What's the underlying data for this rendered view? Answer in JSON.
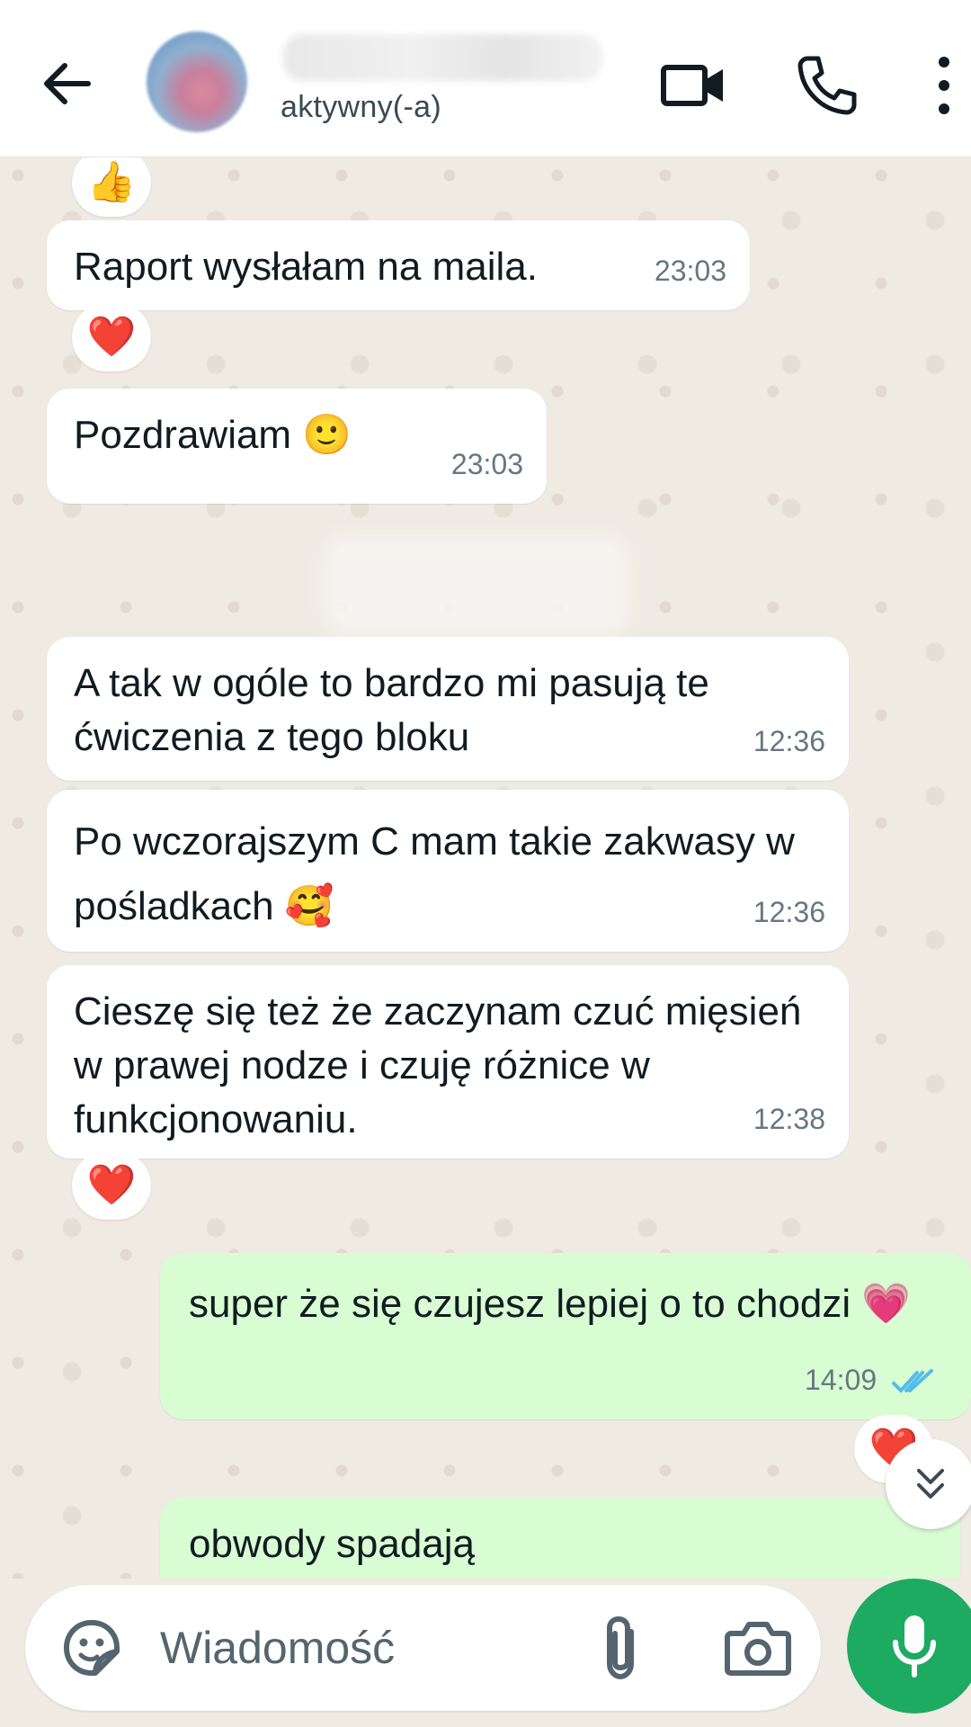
{
  "header": {
    "back_icon": "arrow-left-icon",
    "contact_name": "",
    "status": "aktywny(-a)",
    "video_icon": "video-camera-icon",
    "call_icon": "phone-icon",
    "menu_icon": "more-vertical-icon"
  },
  "messages": [
    {
      "direction": "incoming",
      "text": "Raport wysłałam na maila.",
      "time": "23:03",
      "reaction": "❤️"
    },
    {
      "direction": "incoming",
      "text": "Pozdrawiam 🙂",
      "time": "23:03"
    },
    {
      "direction": "incoming",
      "text": "A tak w ogóle to bardzo mi pasują te ćwiczenia z tego bloku",
      "time": "12:36"
    },
    {
      "direction": "incoming",
      "text": "Po wczorajszym C mam takie zakwasy w pośladkach 🥰",
      "time": "12:36"
    },
    {
      "direction": "incoming",
      "text": "Cieszę się też że zaczynam czuć mięsień w prawej nodze i czuję różnice w funkcjonowaniu.",
      "time": "12:38",
      "reaction": "❤️"
    },
    {
      "direction": "outgoing",
      "text": "super że się czujesz lepiej o to chodzi 💗",
      "time": "14:09",
      "status": "read",
      "reaction": "❤️"
    },
    {
      "direction": "outgoing",
      "text": "obwody spadają"
    }
  ],
  "top_reaction": "👍",
  "input": {
    "placeholder": "Wiadomość",
    "sticker_icon": "sticker-icon",
    "attach_icon": "paperclip-icon",
    "camera_icon": "camera-icon",
    "mic_icon": "microphone-icon"
  },
  "scroll_down_icon": "double-chevron-down-icon",
  "colors": {
    "header_bg": "#ffffff",
    "chat_bg": "#efeae2",
    "incoming_bubble": "#ffffff",
    "outgoing_bubble": "#d9fdd3",
    "accent_green": "#1daa61",
    "read_ticks": "#53bdeb"
  }
}
